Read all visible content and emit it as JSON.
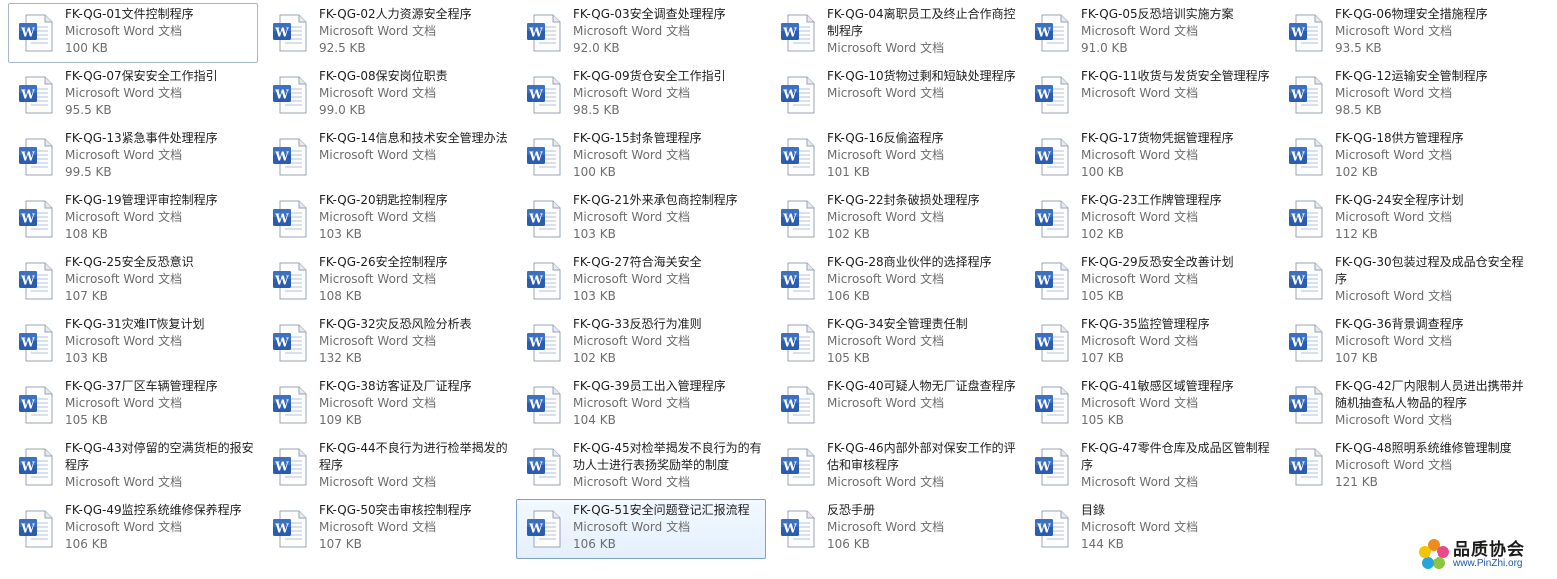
{
  "files": [
    {
      "name": "FK-QG-01文件控制程序",
      "type": "Microsoft Word 文档",
      "size": "100 KB",
      "state": "focused"
    },
    {
      "name": "FK-QG-02人力资源安全程序",
      "type": "Microsoft Word 文档",
      "size": "92.5 KB"
    },
    {
      "name": "FK-QG-03安全调查处理程序",
      "type": "Microsoft Word 文档",
      "size": "92.0 KB"
    },
    {
      "name": "FK-QG-04离职员工及终止合作商控制程序",
      "type": "Microsoft Word 文档",
      "size": ""
    },
    {
      "name": "FK-QG-05反恐培训实施方案",
      "type": "Microsoft Word 文档",
      "size": "91.0 KB"
    },
    {
      "name": "FK-QG-06物理安全措施程序",
      "type": "Microsoft Word 文档",
      "size": "93.5 KB"
    },
    {
      "name": "FK-QG-07保安安全工作指引",
      "type": "Microsoft Word 文档",
      "size": "95.5 KB"
    },
    {
      "name": "FK-QG-08保安岗位职责",
      "type": "Microsoft Word 文档",
      "size": "99.0 KB"
    },
    {
      "name": "FK-QG-09货仓安全工作指引",
      "type": "Microsoft Word 文档",
      "size": "98.5 KB"
    },
    {
      "name": "FK-QG-10货物过剩和短缺处理程序",
      "type": "Microsoft Word 文档",
      "size": ""
    },
    {
      "name": "FK-QG-11收货与发货安全管理程序",
      "type": "Microsoft Word 文档",
      "size": ""
    },
    {
      "name": "FK-QG-12运输安全管制程序",
      "type": "Microsoft Word 文档",
      "size": "98.5 KB"
    },
    {
      "name": "FK-QG-13紧急事件处理程序",
      "type": "Microsoft Word 文档",
      "size": "99.5 KB"
    },
    {
      "name": "FK-QG-14信息和技术安全管理办法",
      "type": "Microsoft Word 文档",
      "size": ""
    },
    {
      "name": "FK-QG-15封条管理程序",
      "type": "Microsoft Word 文档",
      "size": "100 KB"
    },
    {
      "name": "FK-QG-16反偷盗程序",
      "type": "Microsoft Word 文档",
      "size": "101 KB"
    },
    {
      "name": "FK-QG-17货物凭据管理程序",
      "type": "Microsoft Word 文档",
      "size": "100 KB"
    },
    {
      "name": "FK-QG-18供方管理程序",
      "type": "Microsoft Word 文档",
      "size": "102 KB"
    },
    {
      "name": "FK-QG-19管理评审控制程序",
      "type": "Microsoft Word 文档",
      "size": "108 KB"
    },
    {
      "name": "FK-QG-20钥匙控制程序",
      "type": "Microsoft Word 文档",
      "size": "103 KB"
    },
    {
      "name": "FK-QG-21外来承包商控制程序",
      "type": "Microsoft Word 文档",
      "size": "103 KB"
    },
    {
      "name": "FK-QG-22封条破损处理程序",
      "type": "Microsoft Word 文档",
      "size": "102 KB"
    },
    {
      "name": "FK-QG-23工作牌管理程序",
      "type": "Microsoft Word 文档",
      "size": "102 KB"
    },
    {
      "name": "FK-QG-24安全程序计划",
      "type": "Microsoft Word 文档",
      "size": "112 KB"
    },
    {
      "name": "FK-QG-25安全反恐意识",
      "type": "Microsoft Word 文档",
      "size": "107 KB"
    },
    {
      "name": "FK-QG-26安全控制程序",
      "type": "Microsoft Word 文档",
      "size": "108 KB"
    },
    {
      "name": "FK-QG-27符合海关安全",
      "type": "Microsoft Word 文档",
      "size": "103 KB"
    },
    {
      "name": "FK-QG-28商业伙伴的选择程序",
      "type": "Microsoft Word 文档",
      "size": "106 KB"
    },
    {
      "name": "FK-QG-29反恐安全改善计划",
      "type": "Microsoft Word 文档",
      "size": "105 KB"
    },
    {
      "name": "FK-QG-30包装过程及成品仓安全程序",
      "type": "Microsoft Word 文档",
      "size": ""
    },
    {
      "name": "FK-QG-31灾难IT恢复计划",
      "type": "Microsoft Word 文档",
      "size": "103 KB"
    },
    {
      "name": "FK-QG-32灾反恐风险分析表",
      "type": "Microsoft Word 文档",
      "size": "132 KB"
    },
    {
      "name": "FK-QG-33反恐行为准则",
      "type": "Microsoft Word 文档",
      "size": "102 KB"
    },
    {
      "name": "FK-QG-34安全管理责任制",
      "type": "Microsoft Word 文档",
      "size": "105 KB"
    },
    {
      "name": "FK-QG-35监控管理程序",
      "type": "Microsoft Word 文档",
      "size": "107 KB"
    },
    {
      "name": "FK-QG-36背景调查程序",
      "type": "Microsoft Word 文档",
      "size": "107 KB"
    },
    {
      "name": "FK-QG-37厂区车辆管理程序",
      "type": "Microsoft Word 文档",
      "size": "105 KB"
    },
    {
      "name": "FK-QG-38访客证及厂证程序",
      "type": "Microsoft Word 文档",
      "size": "109 KB"
    },
    {
      "name": "FK-QG-39员工出入管理程序",
      "type": "Microsoft Word 文档",
      "size": "104 KB"
    },
    {
      "name": "FK-QG-40可疑人物无厂证盘查程序",
      "type": "Microsoft Word 文档",
      "size": ""
    },
    {
      "name": "FK-QG-41敏感区域管理程序",
      "type": "Microsoft Word 文档",
      "size": "105 KB"
    },
    {
      "name": "FK-QG-42厂内限制人员进出携带并随机抽查私人物品的程序",
      "type": "Microsoft Word 文档",
      "size": ""
    },
    {
      "name": "FK-QG-43对停留的空满货柜的报安程序",
      "type": "Microsoft Word 文档",
      "size": ""
    },
    {
      "name": "FK-QG-44不良行为进行检举揭发的程序",
      "type": "Microsoft Word 文档",
      "size": ""
    },
    {
      "name": "FK-QG-45对检举揭发不良行为的有功人士进行表扬奖励举的制度",
      "type": "Microsoft Word 文档",
      "size": ""
    },
    {
      "name": "FK-QG-46内部外部对保安工作的评估和审核程序",
      "type": "Microsoft Word 文档",
      "size": ""
    },
    {
      "name": "FK-QG-47零件仓库及成品区管制程序",
      "type": "Microsoft Word 文档",
      "size": ""
    },
    {
      "name": "FK-QG-48照明系统维修管理制度",
      "type": "Microsoft Word 文档",
      "size": "121 KB"
    },
    {
      "name": "FK-QG-49监控系统维修保养程序",
      "type": "Microsoft Word 文档",
      "size": "106 KB"
    },
    {
      "name": "FK-QG-50突击审核控制程序",
      "type": "Microsoft Word 文档",
      "size": "107 KB"
    },
    {
      "name": "FK-QG-51安全问题登记汇报流程",
      "type": "Microsoft Word 文档",
      "size": "106 KB",
      "state": "selected"
    },
    {
      "name": "反恐手册",
      "type": "Microsoft Word 文档",
      "size": "106 KB"
    },
    {
      "name": "目錄",
      "type": "Microsoft Word 文档",
      "size": "144 KB"
    }
  ],
  "watermark": {
    "brand": "品质协会",
    "url": "www.PinZhi.org"
  },
  "colors": {
    "selection_border": "#7da2ce",
    "word_blue": "#2a5db0"
  }
}
